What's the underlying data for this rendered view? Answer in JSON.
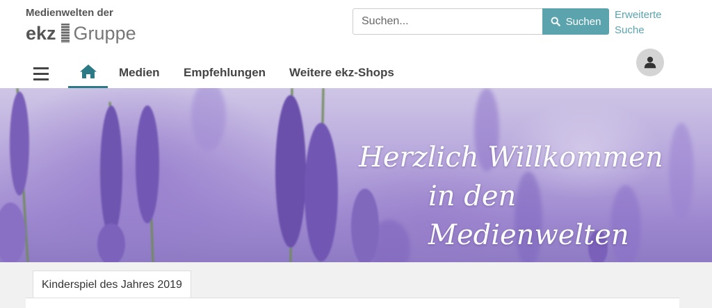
{
  "logo": {
    "line1": "Medienwelten der",
    "ekz": "ekz",
    "gruppe": "Gruppe"
  },
  "search": {
    "placeholder": "Suchen...",
    "button_label": "Suchen",
    "advanced_label": "Erweiterte Suche"
  },
  "nav": {
    "items": [
      {
        "label": "Medien"
      },
      {
        "label": "Empfehlungen"
      },
      {
        "label": "Weitere ekz-Shops"
      }
    ]
  },
  "hero": {
    "line1": "Herzlich Willkommen",
    "line2": "in den Medienwelten"
  },
  "tabs": [
    {
      "label": "Kinderspiel des Jahres 2019"
    }
  ],
  "colors": {
    "accent": "#5ba4ae",
    "nav_active": "#2c7a85",
    "lavender": "#9e89d0"
  }
}
